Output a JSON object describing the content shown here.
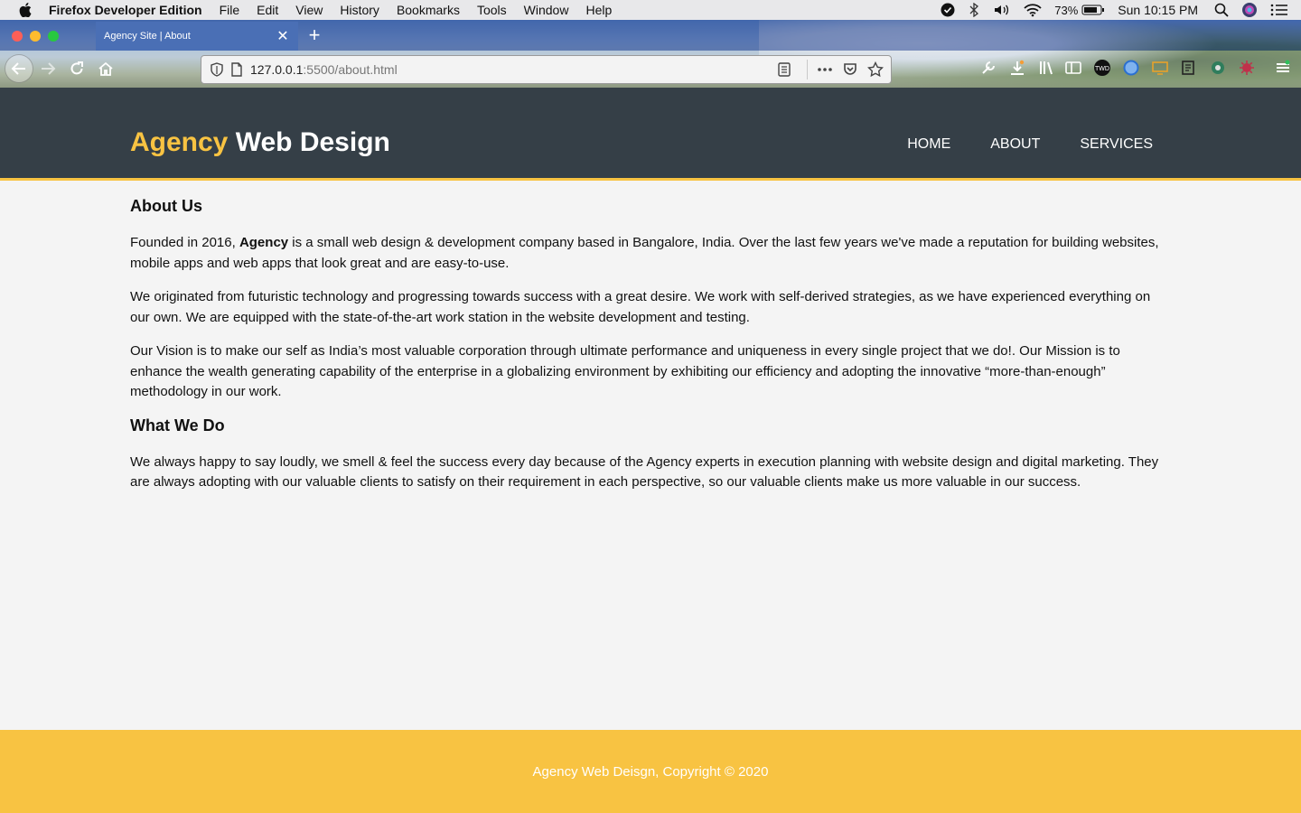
{
  "menubar": {
    "app_name": "Firefox Developer Edition",
    "items": [
      "File",
      "Edit",
      "View",
      "History",
      "Bookmarks",
      "Tools",
      "Window",
      "Help"
    ],
    "battery": "73%",
    "clock": "Sun 10:15 PM"
  },
  "browser": {
    "tab_title": "Agency Site | About",
    "url_host": "127.0.0.1",
    "url_rest": ":5500/about.html"
  },
  "site": {
    "logo_highlight": "Agency",
    "logo_rest": " Web Design",
    "nav": [
      "HOME",
      "ABOUT",
      "SERVICES"
    ],
    "about_heading": "About Us",
    "p1_prefix": "Founded in 2016, ",
    "p1_bold": "Agency",
    "p1_suffix": " is a small web design & development company based in Bangalore, India. Over the last few years we've made a reputation for building websites, mobile apps and web apps that look great and are easy-to-use.",
    "p2": "We originated from futuristic technology and progressing towards success with a great desire. We work with self-derived strategies, as we have experienced everything on our own. We are equipped with the state-of-the-art work station in the website development and testing.",
    "p3": "Our Vision is to make our self as India’s most valuable corporation through ultimate performance and uniqueness in every single project that we do!. Our Mission is to enhance the wealth generating capability of the enterprise in a globalizing environment by exhibiting our efficiency and adopting the innovative “more-than-enough” methodology in our work.",
    "whatwedo_heading": "What We Do",
    "p4": "We always happy to say loudly, we smell & feel the success every day because of the Agency experts in execution planning with website design and digital marketing. They are always adopting with our valuable clients to satisfy on their requirement in each perspective, so our valuable clients make us more valuable in our success.",
    "footer": "Agency Web Deisgn, Copyright © 2020"
  },
  "colors": {
    "accent": "#f8c342",
    "header_bg": "#353f47",
    "page_bg": "#f4f4f4"
  }
}
